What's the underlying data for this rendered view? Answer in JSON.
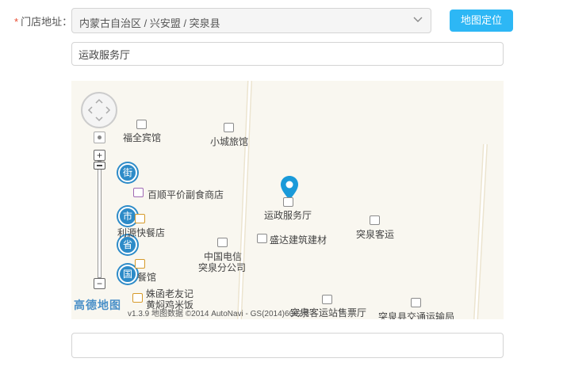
{
  "form": {
    "label": "门店地址：",
    "required_mark": "*",
    "region_value": "内蒙古自治区 / 兴安盟 / 突泉县",
    "locate_button": "地图定位",
    "address_value": "运政服务厅",
    "extra_value": ""
  },
  "map": {
    "pois": [
      {
        "name": "福全宾馆"
      },
      {
        "name": "小城旅馆"
      },
      {
        "name": "百顺平价副食商店"
      },
      {
        "name": "利源快餐店"
      },
      {
        "name": "运政服务厅"
      },
      {
        "name": "盛达建筑建材"
      },
      {
        "name": "突泉客运"
      },
      {
        "name": "中国电信"
      },
      {
        "name": "突泉分公司"
      },
      {
        "name": "餐馆"
      },
      {
        "name": "姝函老友记"
      },
      {
        "name": "黄焖鸡米饭"
      },
      {
        "name": "突泉客运站售票厅"
      },
      {
        "name": "突泉县交通运输局"
      }
    ],
    "zoom_levels": [
      "街",
      "市",
      "省",
      "国"
    ],
    "zoom_in": "+",
    "zoom_out": "−",
    "logo": "高德地图",
    "copyright": "v1.3.9 地图数据 ©2014 AutoNavi - GS(2014)6002号"
  }
}
